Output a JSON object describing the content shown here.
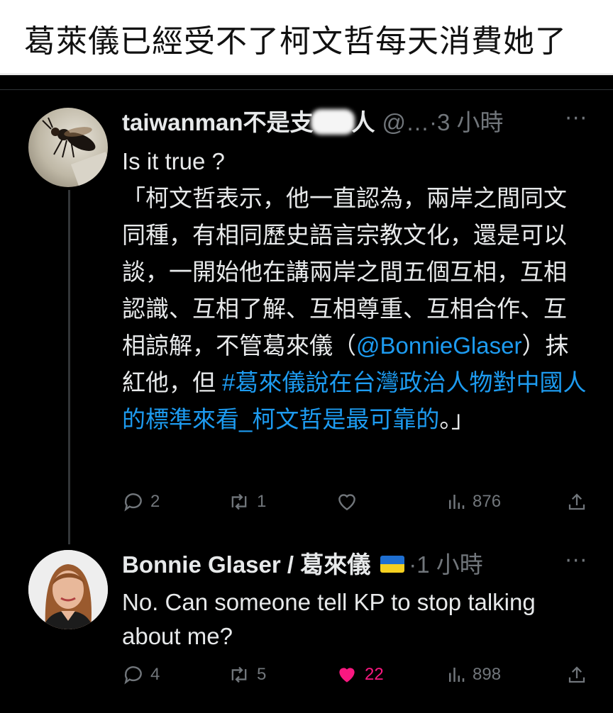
{
  "caption": "葛萊儀已經受不了柯文哲每天消費她了",
  "tweet1": {
    "name_part1": "taiwanman不是支",
    "name_part2": "人",
    "handle": "@…",
    "time": "·3 小時",
    "more": "···",
    "text_line1": "Is it true ?",
    "text_quote_a": "「柯文哲表示，他一直認為，兩岸之間同文同種，有相同歷史語言宗教文化，還是可以談，一開始他在講兩岸之間五個互相，互相認識、互相了解、互相尊重、互相合作、互相諒解，不管葛來儀（",
    "mention": "@BonnieGlaser",
    "text_quote_b": "）抹紅他，但 ",
    "hashtag": "#葛來儀說在台灣政治人物對中國人的標準來看_柯文哲是最可靠的",
    "text_quote_c": "。」",
    "replies": "2",
    "retweets": "1",
    "views": "876",
    "avatar_icon": "wasp-avatar-icon"
  },
  "tweet2": {
    "name": "Bonnie Glaser / 葛來儀",
    "time": "·1 小時",
    "more": "···",
    "flag_icon": "ukraine-flag-icon",
    "text": "No. Can someone tell KP to stop talking about me?",
    "replies": "4",
    "retweets": "5",
    "likes": "22",
    "views": "898",
    "like_color": "#f91880"
  }
}
